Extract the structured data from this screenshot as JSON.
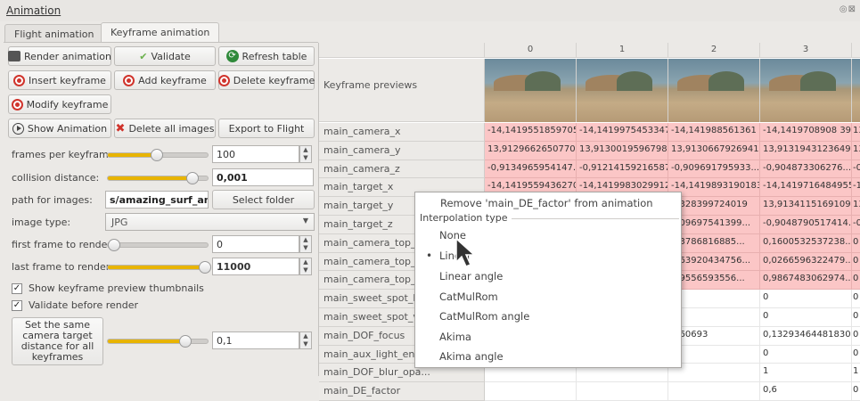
{
  "window": {
    "title": "Animation",
    "controls": "◎⊠"
  },
  "tabs": [
    "Flight animation",
    "Keyframe animation"
  ],
  "buttons": {
    "render": "Render animation",
    "validate": "Validate",
    "refresh": "Refresh table",
    "insert": "Insert keyframe",
    "add": "Add keyframe",
    "delete": "Delete keyframe",
    "modify": "Modify keyframe",
    "show": "Show Animation",
    "delete_all": "Delete all images",
    "export": "Export to Flight",
    "select_folder": "Select folder"
  },
  "settings": {
    "frames_per_keyframe": {
      "label": "frames per keyframe:",
      "value": "100"
    },
    "collision_distance": {
      "label": "collision distance:",
      "value": "0,001"
    },
    "path_for_images": {
      "label": "path for images:",
      "value": "s/amazing_surf_anim/"
    },
    "image_type": {
      "label": "image type:",
      "value": "JPG"
    },
    "first_frame": {
      "label": "first frame to render:",
      "value": "0"
    },
    "last_frame": {
      "label": "last frame to render:",
      "value": "11000"
    },
    "show_thumbnails": {
      "label": "Show keyframe preview thumbnails",
      "checked": "✓"
    },
    "validate_before": {
      "label": "Validate before render",
      "checked": "✓"
    },
    "same_distance": {
      "label": "Set the same camera target distance for all keyframes",
      "value": "0,1"
    }
  },
  "table": {
    "columns": [
      "0",
      "1",
      "2",
      "3"
    ],
    "preview_label": "Keyframe previews",
    "rows": [
      {
        "name": "main_camera_x",
        "cells": [
          "-14,14195518597055",
          "-14,1419975453347",
          "-14,141988561361 85",
          "-14,1419708908 39..."
        ]
      },
      {
        "name": "main_camera_y",
        "cells": [
          "13,91296626507707",
          "13,91300195967982",
          "13,91306679269415",
          "13,91319431236494"
        ]
      },
      {
        "name": "main_camera_z",
        "cells": [
          "-0,9134965954147...",
          "-0,912141592165872 1",
          "-0,909691795933...",
          "-0,904873306276..."
        ]
      },
      {
        "name": "main_target_x",
        "cells": [
          "-14,14195594362708",
          "-14,14199830299123",
          "-14,14198931901838",
          "-14,14197164849555"
        ]
      },
      {
        "name": "main_target_y",
        "cells": [
          "",
          "",
          "...328399724019",
          "13,91341151691098"
        ]
      },
      {
        "name": "main_target_z",
        "cells": [
          "",
          "",
          "...09697541399...",
          "-0,9048790517414..."
        ]
      },
      {
        "name": "main_camera_top_x",
        "cells": [
          "",
          "",
          "...3786816885...",
          "0,1600532537238..."
        ]
      },
      {
        "name": "main_camera_top_y",
        "cells": [
          "",
          "",
          "...63920434756...",
          "0,0266596322479..."
        ]
      },
      {
        "name": "main_camera_top_z",
        "cells": [
          "",
          "",
          "...9556593556...",
          "0,9867483062974..."
        ]
      },
      {
        "name": "main_sweet_spot_hori...",
        "cells": [
          "",
          "",
          "",
          "0"
        ]
      },
      {
        "name": "main_sweet_spot_ver...",
        "cells": [
          "",
          "",
          "",
          "0"
        ]
      },
      {
        "name": "main_DOF_focus",
        "cells": [
          "",
          "",
          "...60693",
          "0,132934644818306"
        ]
      },
      {
        "name": "main_aux_light_enab...",
        "cells": [
          "",
          "",
          "",
          "0"
        ]
      },
      {
        "name": "main_DOF_blur_opa...",
        "cells": [
          "",
          "",
          "",
          "1"
        ]
      },
      {
        "name": "main_DE_factor",
        "cells": [
          "",
          "",
          "",
          "0,6"
        ]
      }
    ],
    "edge_cells": [
      "13",
      "13",
      "-0",
      "-1",
      "13",
      "-0",
      "0",
      "0",
      "0",
      "0",
      "0",
      "0",
      "0",
      "1",
      "0"
    ]
  },
  "context_menu": {
    "remove": "Remove 'main_DE_factor' from animation",
    "section": "Interpolation type",
    "items": [
      "None",
      "Linear",
      "Linear angle",
      "CatMulRom",
      "CatMulRom angle",
      "Akima",
      "Akima angle"
    ],
    "selected_bullet": "•"
  }
}
